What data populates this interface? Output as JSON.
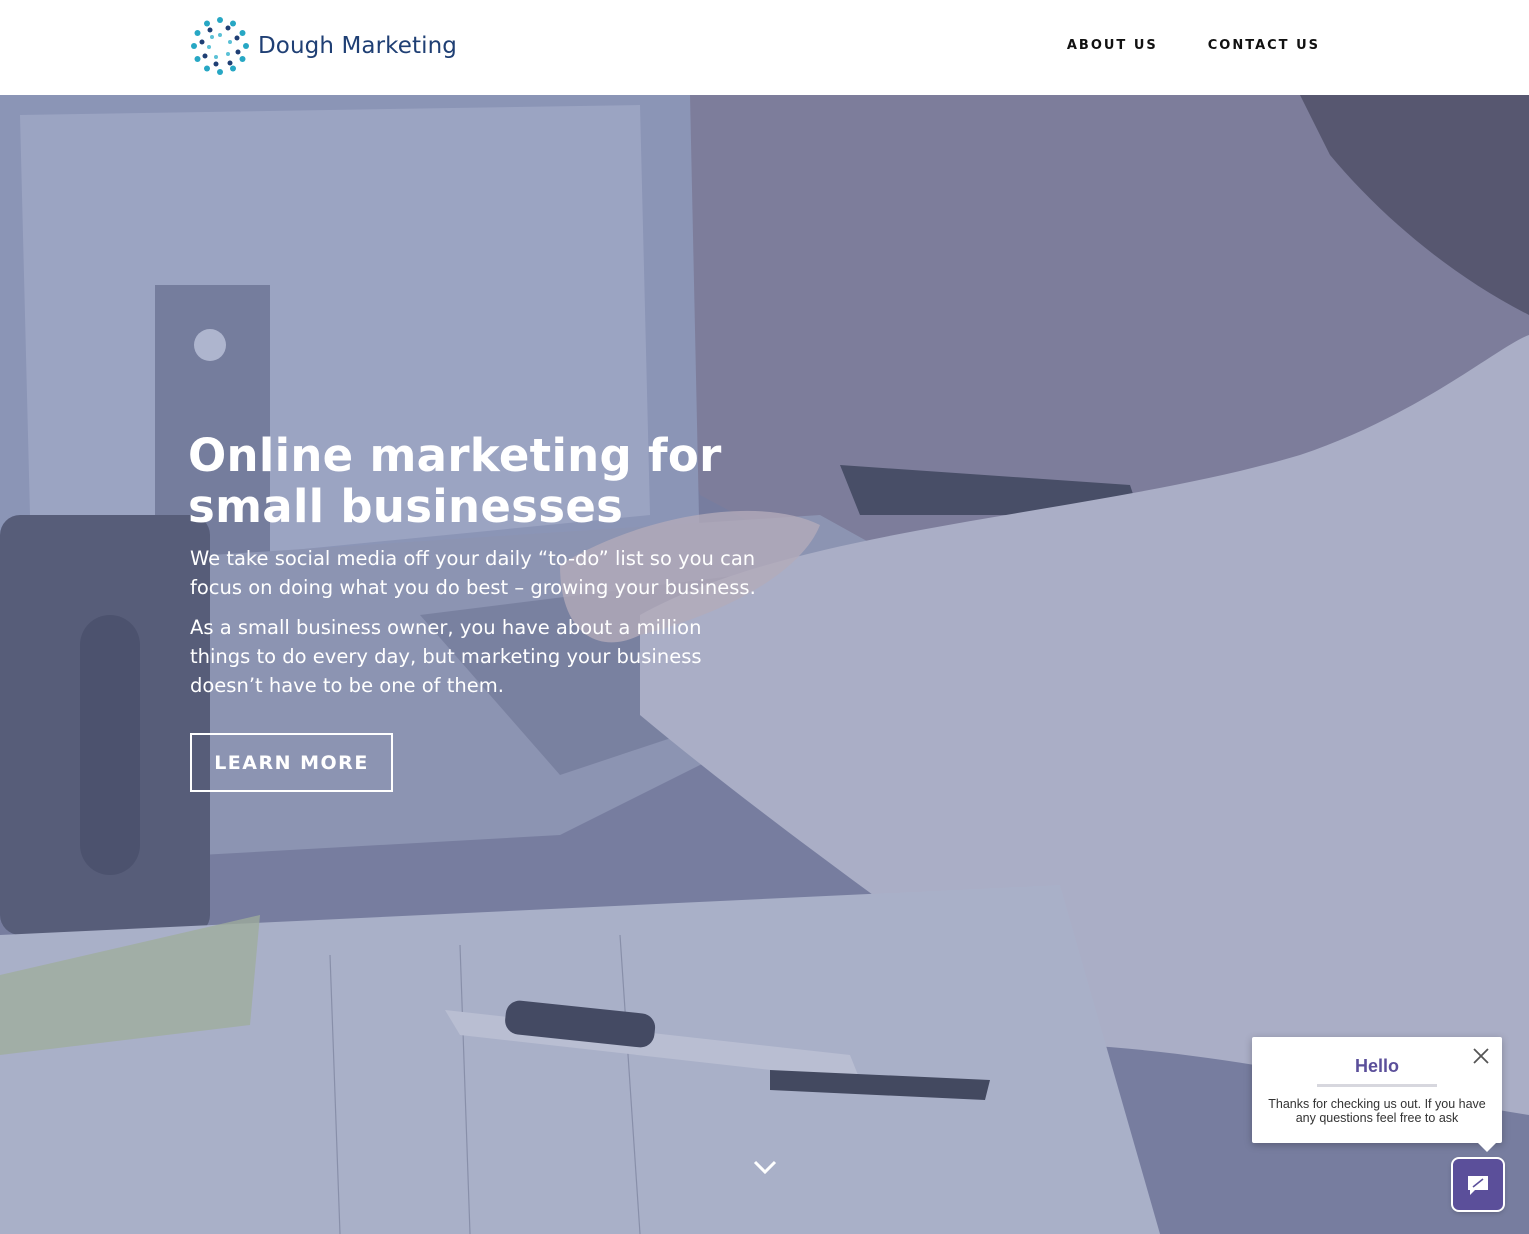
{
  "brand": {
    "name": "Dough Marketing",
    "logo_icon": "dotted-circle-logo-icon"
  },
  "nav": {
    "items": [
      {
        "label": "ABOUT US"
      },
      {
        "label": "CONTACT US"
      }
    ]
  },
  "hero": {
    "title_line1": "Online marketing for",
    "title_line2": "small businesses",
    "subtitle": "We take social media off your daily “to-do” list so you can focus on doing what you do best – growing your business.",
    "body": "As a small business owner, you have about a million things to do every day, but marketing your business doesn’t have to be one of them.",
    "cta_label": "LEARN MORE",
    "scroll_icon": "chevron-down-icon"
  },
  "chat": {
    "title": "Hello",
    "message": "Thanks for checking us out. If you have any questions feel free to ask",
    "close_icon": "close-icon",
    "launcher_icon": "chat-bubble-icon"
  },
  "colors": {
    "brand_navy": "#1f3f74",
    "brand_teal": "#27a7c4",
    "hero_overlay": "#6f7a9e",
    "chat_purple": "#5b4f9a"
  }
}
